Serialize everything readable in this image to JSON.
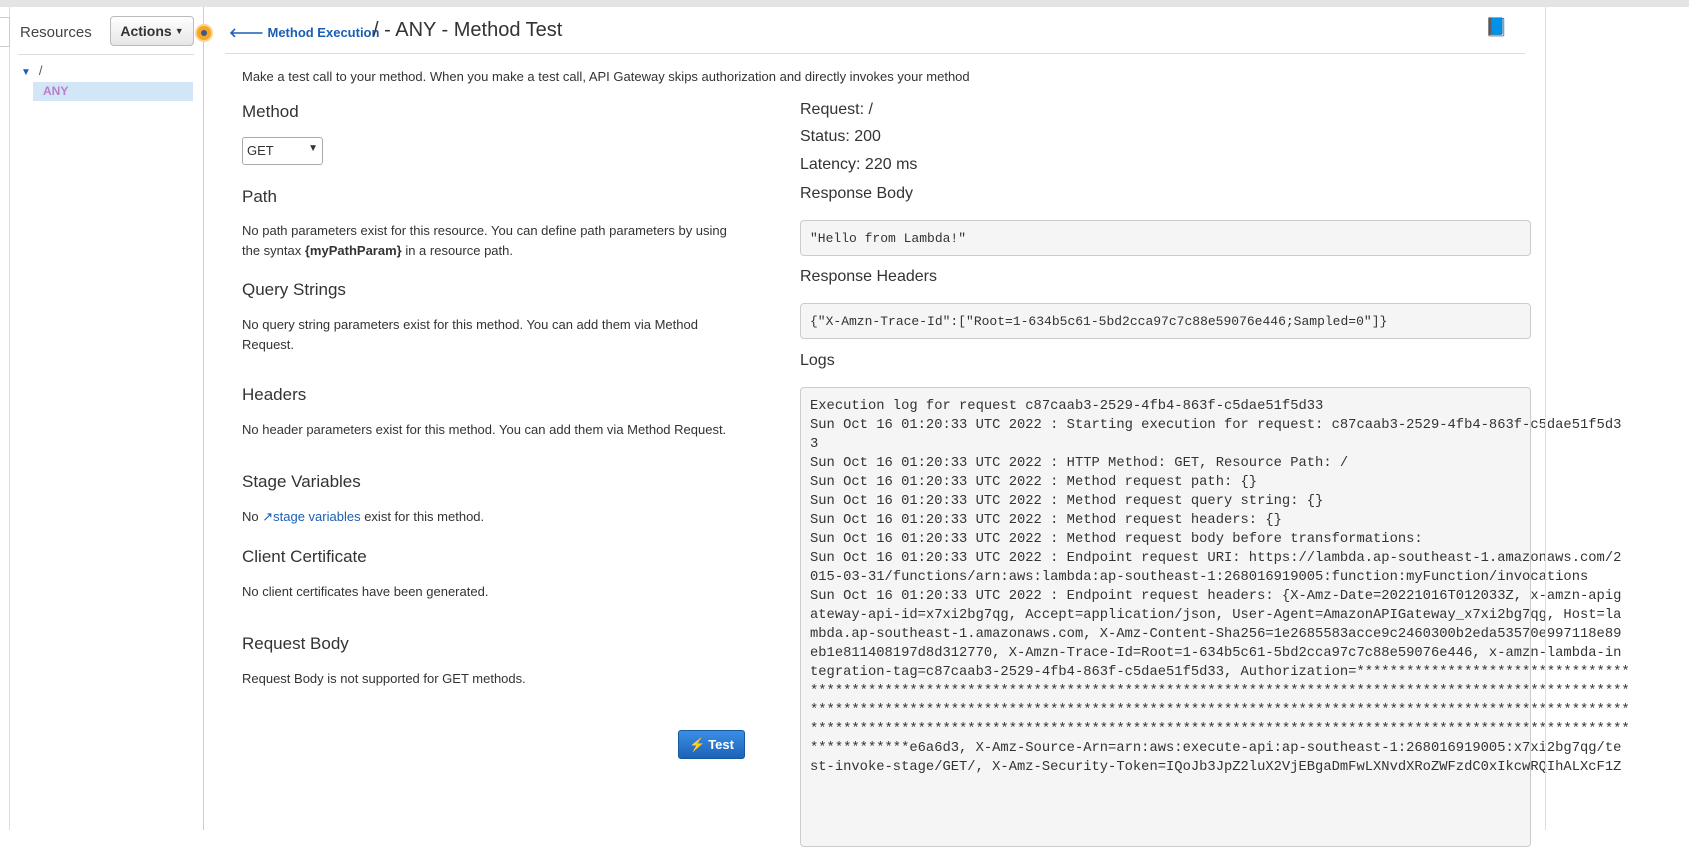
{
  "sidebar": {
    "title": "Resources",
    "actions_label": "Actions",
    "tree": {
      "root": "/",
      "selected": "ANY"
    }
  },
  "header": {
    "back_label": "Method Execution",
    "title": "/ - ANY - Method Test"
  },
  "intro": "Make a test call to your method. When you make a test call, API Gateway skips authorization and directly invokes your method",
  "left": {
    "method": {
      "heading": "Method",
      "selected": "GET"
    },
    "path": {
      "heading": "Path",
      "text1": "No path parameters exist for this resource. You can define path parameters by using the syntax ",
      "bold": "{myPathParam}",
      "text2": " in a resource path."
    },
    "query": {
      "heading": "Query Strings",
      "text": "No query string parameters exist for this method. You can add them via Method Request."
    },
    "headers": {
      "heading": "Headers",
      "text": "No header parameters exist for this method. You can add them via Method Request."
    },
    "stage": {
      "heading": "Stage Variables",
      "pre": "No ",
      "link": "stage variables",
      "post": " exist for this method."
    },
    "cert": {
      "heading": "Client Certificate",
      "text": "No client certificates have been generated."
    },
    "body": {
      "heading": "Request Body",
      "text": "Request Body is not supported for GET methods."
    },
    "test_label": "Test"
  },
  "right": {
    "request": "Request: /",
    "status": "Status: 200",
    "latency": "Latency: 220 ms",
    "response_body_heading": "Response Body",
    "response_body": "\"Hello from Lambda!\"",
    "response_headers_heading": "Response Headers",
    "response_headers": "{\"X-Amzn-Trace-Id\":[\"Root=1-634b5c61-5bd2cca97c7c88e59076e446;Sampled=0\"]}",
    "logs_heading": "Logs",
    "logs": [
      "Execution log for request c87caab3-2529-4fb4-863f-c5dae51f5d33",
      "Sun Oct 16 01:20:33 UTC 2022 : Starting execution for request: c87caab3-2529-4fb4-863f-c5dae51f5d3",
      "3",
      "Sun Oct 16 01:20:33 UTC 2022 : HTTP Method: GET, Resource Path: /",
      "Sun Oct 16 01:20:33 UTC 2022 : Method request path: {}",
      "Sun Oct 16 01:20:33 UTC 2022 : Method request query string: {}",
      "Sun Oct 16 01:20:33 UTC 2022 : Method request headers: {}",
      "Sun Oct 16 01:20:33 UTC 2022 : Method request body before transformations:",
      "Sun Oct 16 01:20:33 UTC 2022 : Endpoint request URI: https://lambda.ap-southeast-1.amazonaws.com/2",
      "015-03-31/functions/arn:aws:lambda:ap-southeast-1:268016919005:function:myFunction/invocations",
      "Sun Oct 16 01:20:33 UTC 2022 : Endpoint request headers: {X-Amz-Date=20221016T012033Z, x-amzn-apig",
      "ateway-api-id=x7xi2bg7qg, Accept=application/json, User-Agent=AmazonAPIGateway_x7xi2bg7qg, Host=la",
      "mbda.ap-southeast-1.amazonaws.com, X-Amz-Content-Sha256=1e2685583acce9c2460300b2eda53570e997118e89",
      "eb1e811408197d8d312770, X-Amzn-Trace-Id=Root=1-634b5c61-5bd2cca97c7c88e59076e446, x-amzn-lambda-in",
      "tegration-tag=c87caab3-2529-4fb4-863f-c5dae51f5d33, Authorization=*********************************",
      "***************************************************************************************************",
      "***************************************************************************************************",
      "***************************************************************************************************",
      "************e6a6d3, X-Amz-Source-Arn=arn:aws:execute-api:ap-southeast-1:268016919005:x7xi2bg7qg/te",
      "st-invoke-stage/GET/, X-Amz-Security-Token=IQoJb3JpZ2luX2VjEBgaDmFwLXNvdXRoZWFzdC0xIkcwRQIhALXcF1Z"
    ]
  }
}
